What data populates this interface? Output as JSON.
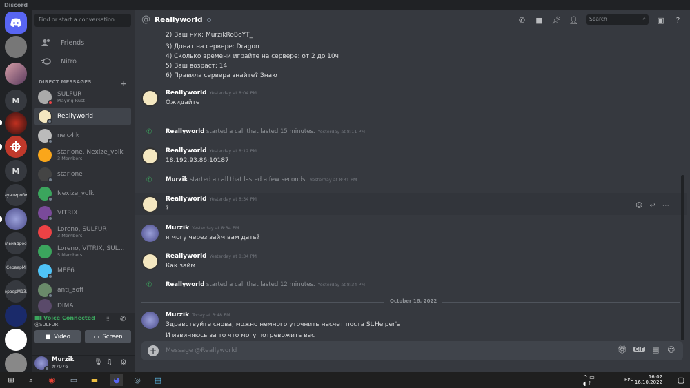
{
  "app": {
    "title": "Discord"
  },
  "guilds": [
    "M",
    "M",
    "аунтироби",
    "ыльнадросе",
    "СерверМ",
    "ерверМ13."
  ],
  "sidebar": {
    "search_placeholder": "Find or start a conversation",
    "friends": "Friends",
    "nitro": "Nitro",
    "dm_header": "DIRECT MESSAGES",
    "dms": [
      {
        "name": "SULFUR",
        "sub": "Playing Rust"
      },
      {
        "name": "Reallyworld",
        "sub": ""
      },
      {
        "name": "nelc4ik",
        "sub": ""
      },
      {
        "name": "starlone, Nexize_volk",
        "sub": "3 Members"
      },
      {
        "name": "starlone",
        "sub": ""
      },
      {
        "name": "Nexize_volk",
        "sub": ""
      },
      {
        "name": "VITRIX",
        "sub": ""
      },
      {
        "name": "Loreno, SULFUR",
        "sub": "3 Members"
      },
      {
        "name": "Loreno, VITRIX, SULF...",
        "sub": "5 Members"
      },
      {
        "name": "MEE6",
        "sub": ""
      },
      {
        "name": "anti_soft",
        "sub": ""
      },
      {
        "name": "DIMA",
        "sub": ""
      }
    ],
    "voice": {
      "status": "Voice Connected",
      "channel": "@SULFUR",
      "video": "Video",
      "screen": "Screen"
    },
    "user": {
      "name": "Murzik",
      "tag": "#7076"
    }
  },
  "header": {
    "title": "Reallyworld",
    "search": "Search"
  },
  "messages": {
    "top_lines": [
      "2) Ваш ник: MurzikRoBoYT_",
      "3) Донат на сервере: Dragon",
      "4) Сколько времени играйте на сервере: от 2 до 10ч",
      "5) Ваш возраст: 14",
      "6) Правила сервера знайте? Знаю"
    ],
    "m1": {
      "author": "Reallyworld",
      "time": "Yesterday at 8:04 PM",
      "text": "Ожидайте"
    },
    "c1": {
      "who": "Reallyworld",
      "text": "started a call that lasted 15 minutes.",
      "time": "Yesterday at 8:11 PM"
    },
    "m2": {
      "author": "Reallyworld",
      "time": "Yesterday at 8:12 PM",
      "text": "18.192.93.86:10187"
    },
    "c2": {
      "who": "Murzik",
      "text": "started a call that lasted a few seconds.",
      "time": "Yesterday at 8:31 PM"
    },
    "m3": {
      "author": "Reallyworld",
      "time": "Yesterday at 8:34 PM",
      "text": "?"
    },
    "m4": {
      "author": "Murzik",
      "time": "Yesterday at 8:34 PM",
      "text": "я могу через займ вам дать?"
    },
    "m5": {
      "author": "Reallyworld",
      "time": "Yesterday at 8:34 PM",
      "text": "Как займ"
    },
    "c3": {
      "who": "Reallyworld",
      "text": "started a call that lasted 12 minutes.",
      "time": "Yesterday at 8:34 PM"
    },
    "date": "October 16, 2022",
    "m6": {
      "author": "Murzik",
      "time": "Today at 3:48 PM",
      "text": "Здравствуйте снова, можно немного уточнить насчет поста St.Helper'a",
      "text2": "И извиняюсь за то что могу потревожить вас"
    }
  },
  "composer": {
    "placeholder": "Message @Reallyworld"
  },
  "taskbar": {
    "lang": "РУС",
    "time": "16:02",
    "date": "16.10.2022"
  }
}
